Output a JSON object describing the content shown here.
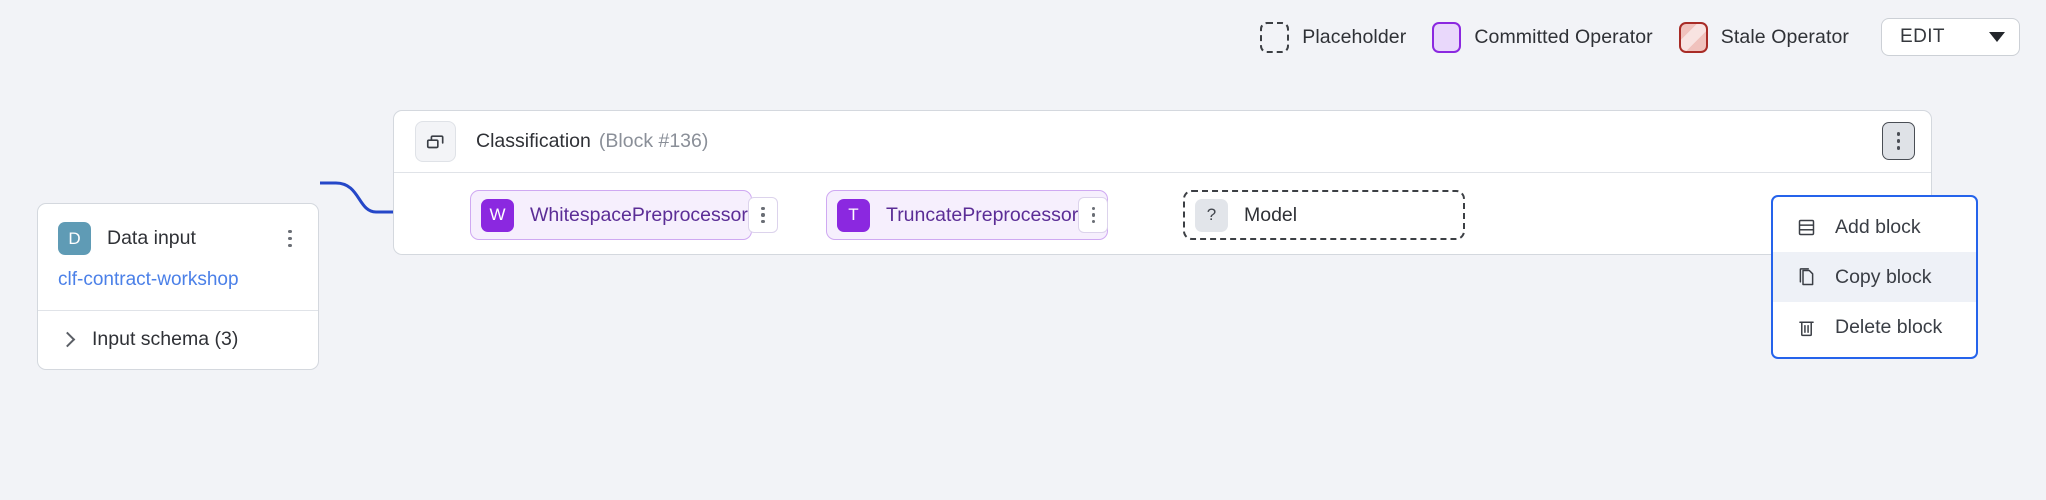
{
  "legend": {
    "items": [
      {
        "label": "Placeholder",
        "swatch": "placeholder-swatch",
        "border_color": "#3c3f44",
        "fill_color": "#f2f3f7"
      },
      {
        "label": "Committed Operator",
        "swatch": "committed-swatch",
        "border_color": "#8b28e0",
        "fill_color": "#e9d8fb"
      },
      {
        "label": "Stale Operator",
        "swatch": "stale-swatch",
        "border_color": "#a82b26",
        "fill_color": "#f0c2bd"
      }
    ],
    "mode_select": {
      "value": "EDIT",
      "icon": "chevron-down-icon"
    }
  },
  "data_input": {
    "badge_letter": "D",
    "badge_color": "#5f9bb5",
    "title": "Data input",
    "menu_icon": "kebab-menu-icon",
    "dataset_link": "clf-contract-workshop",
    "dataset_link_color": "#4b80e8",
    "schema": {
      "label": "Input schema (3)",
      "expand_icon": "chevron-right-icon",
      "count": 3
    }
  },
  "block": {
    "icon": "copy-stack-icon",
    "title": "Classification",
    "subtitle": "(Block #136)",
    "block_number": "#136",
    "menu_icon": "kebab-menu-icon",
    "operators": [
      {
        "badge_letter": "W",
        "name": "WhitespacePreprocessor",
        "state": "committed",
        "menu_icon": "kebab-menu-icon"
      },
      {
        "badge_letter": "T",
        "name": "TruncatePreprocessor",
        "state": "committed",
        "menu_icon": "kebab-menu-icon"
      },
      {
        "badge_letter": "?",
        "name": "Model",
        "state": "placeholder",
        "menu_icon": "kebab-menu-icon"
      }
    ]
  },
  "context_menu": {
    "accent_color": "#2563eb",
    "items": [
      {
        "label": "Add block",
        "icon": "add-block-icon",
        "active": false
      },
      {
        "label": "Copy block",
        "icon": "copy-icon",
        "active": true
      },
      {
        "label": "Delete block",
        "icon": "trash-icon",
        "active": false
      }
    ]
  },
  "canvas": {
    "background_color": "#f2f3f7",
    "connector_color": "#2547c8"
  }
}
